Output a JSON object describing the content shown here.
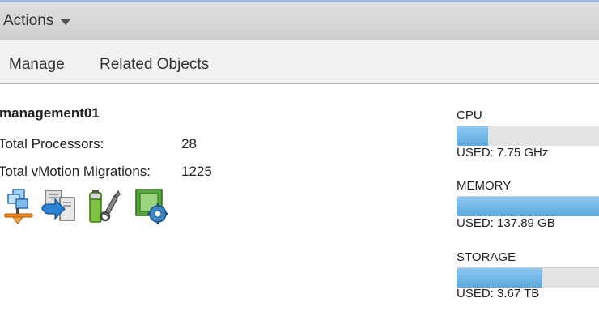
{
  "toolbar": {
    "actions_label": "Actions"
  },
  "tabs": [
    {
      "label": "Manage"
    },
    {
      "label": "Related Objects"
    }
  ],
  "host": {
    "name": "management01",
    "properties": [
      {
        "label": "Total Processors:",
        "value": "28"
      },
      {
        "label": "Total vMotion Migrations:",
        "value": "1225"
      }
    ]
  },
  "action_icons": [
    "migrate-network-icon",
    "vmotion-icon",
    "maintenance-icon",
    "host-settings-icon"
  ],
  "resources": [
    {
      "label": "CPU",
      "used": "USED: 7.75 GHz",
      "fill_percent": 22
    },
    {
      "label": "MEMORY",
      "used": "USED: 137.89 GB",
      "fill_percent": 100
    },
    {
      "label": "STORAGE",
      "used": "USED: 3.67 TB",
      "fill_percent": 60
    }
  ],
  "colors": {
    "bar_fill": "#6fb5e6",
    "bar_track": "#e3e3e3",
    "toolbar_bg": "#d8d8d8",
    "tabs_bg": "#f1f1f1"
  }
}
